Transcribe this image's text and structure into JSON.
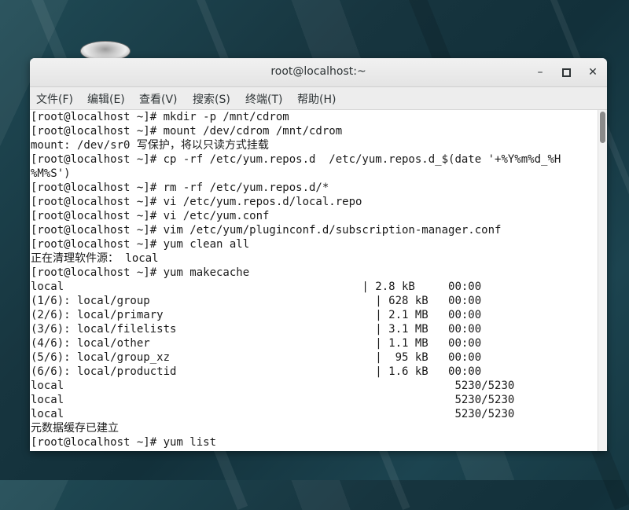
{
  "window": {
    "title": "root@localhost:~",
    "minimize": "–",
    "close": "✕"
  },
  "menu": [
    "文件(F)",
    "编辑(E)",
    "查看(V)",
    "搜索(S)",
    "终端(T)",
    "帮助(H)"
  ],
  "terminal": {
    "lines": [
      "[root@localhost ~]# mkdir -p /mnt/cdrom",
      "[root@localhost ~]# mount /dev/cdrom /mnt/cdrom",
      "mount: /dev/sr0 写保护，将以只读方式挂载",
      "[root@localhost ~]# cp -rf /etc/yum.repos.d  /etc/yum.repos.d_$(date '+%Y%m%d_%H",
      "%M%S')",
      "[root@localhost ~]# rm -rf /etc/yum.repos.d/*",
      "[root@localhost ~]# vi /etc/yum.repos.d/local.repo",
      "[root@localhost ~]# vi /etc/yum.conf",
      "[root@localhost ~]# vim /etc/yum/pluginconf.d/subscription-manager.conf",
      "[root@localhost ~]# yum clean all",
      "正在清理软件源： local",
      "[root@localhost ~]# yum makecache",
      "local                                             | 2.8 kB     00:00",
      "(1/6): local/group                                  | 628 kB   00:00",
      "(2/6): local/primary                                | 2.1 MB   00:00",
      "(3/6): local/filelists                              | 3.1 MB   00:00",
      "(4/6): local/other                                  | 1.1 MB   00:00",
      "(5/6): local/group_xz                               |  95 kB   00:00",
      "(6/6): local/productid                              | 1.6 kB   00:00",
      "local                                                           5230/5230",
      "local                                                           5230/5230",
      "local                                                           5230/5230",
      "元数据缓存已建立",
      "[root@localhost ~]# yum list"
    ]
  }
}
